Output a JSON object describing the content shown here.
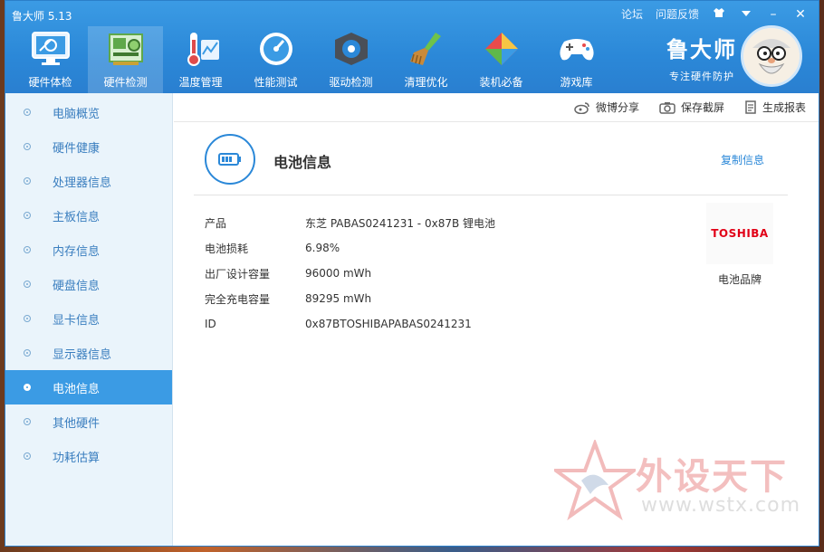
{
  "app": {
    "title": "鲁大师 5.13"
  },
  "top_links": {
    "forum": "论坛",
    "feedback": "问题反馈"
  },
  "window_controls": {
    "skin_icon": "shirt-icon",
    "menu_icon": "menu-icon",
    "minimize": "–",
    "close": "✕"
  },
  "tabs": [
    {
      "label": "硬件体检",
      "icon": "monitor-icon"
    },
    {
      "label": "硬件检测",
      "icon": "circuit-board-icon"
    },
    {
      "label": "温度管理",
      "icon": "thermometer-icon"
    },
    {
      "label": "性能测试",
      "icon": "gauge-icon"
    },
    {
      "label": "驱动检测",
      "icon": "gear-box-icon"
    },
    {
      "label": "清理优化",
      "icon": "broom-icon"
    },
    {
      "label": "装机必备",
      "icon": "package-icon"
    },
    {
      "label": "游戏库",
      "icon": "gamepad-icon"
    }
  ],
  "brand": {
    "name": "鲁大师",
    "slogan": "专注硬件防护"
  },
  "sidebar": {
    "items": [
      {
        "label": "电脑概览"
      },
      {
        "label": "硬件健康"
      },
      {
        "label": "处理器信息"
      },
      {
        "label": "主板信息"
      },
      {
        "label": "内存信息"
      },
      {
        "label": "硬盘信息"
      },
      {
        "label": "显卡信息"
      },
      {
        "label": "显示器信息"
      },
      {
        "label": "电池信息"
      },
      {
        "label": "其他硬件"
      },
      {
        "label": "功耗估算"
      }
    ],
    "active_index": 8
  },
  "toolbar": {
    "share": "微博分享",
    "screenshot": "保存截屏",
    "report": "生成报表"
  },
  "section": {
    "title": "电池信息",
    "copy": "复制信息"
  },
  "info": [
    {
      "label": "产品",
      "value": "东芝 PABAS0241231 - 0x87B 锂电池"
    },
    {
      "label": "电池损耗",
      "value": "6.98%"
    },
    {
      "label": "出厂设计容量",
      "value": "96000 mWh"
    },
    {
      "label": "完全充电容量",
      "value": "89295 mWh"
    },
    {
      "label": "ID",
      "value": "0x87BTOSHIBAPABAS0241231"
    }
  ],
  "battery_brand": {
    "logo_text": "TOSHIBA",
    "caption": "电池品牌"
  },
  "watermark": {
    "text": "外设天下",
    "url": "www.wstx.com"
  },
  "colors": {
    "accent": "#2b88d8",
    "brand_logo": "#e10016"
  }
}
